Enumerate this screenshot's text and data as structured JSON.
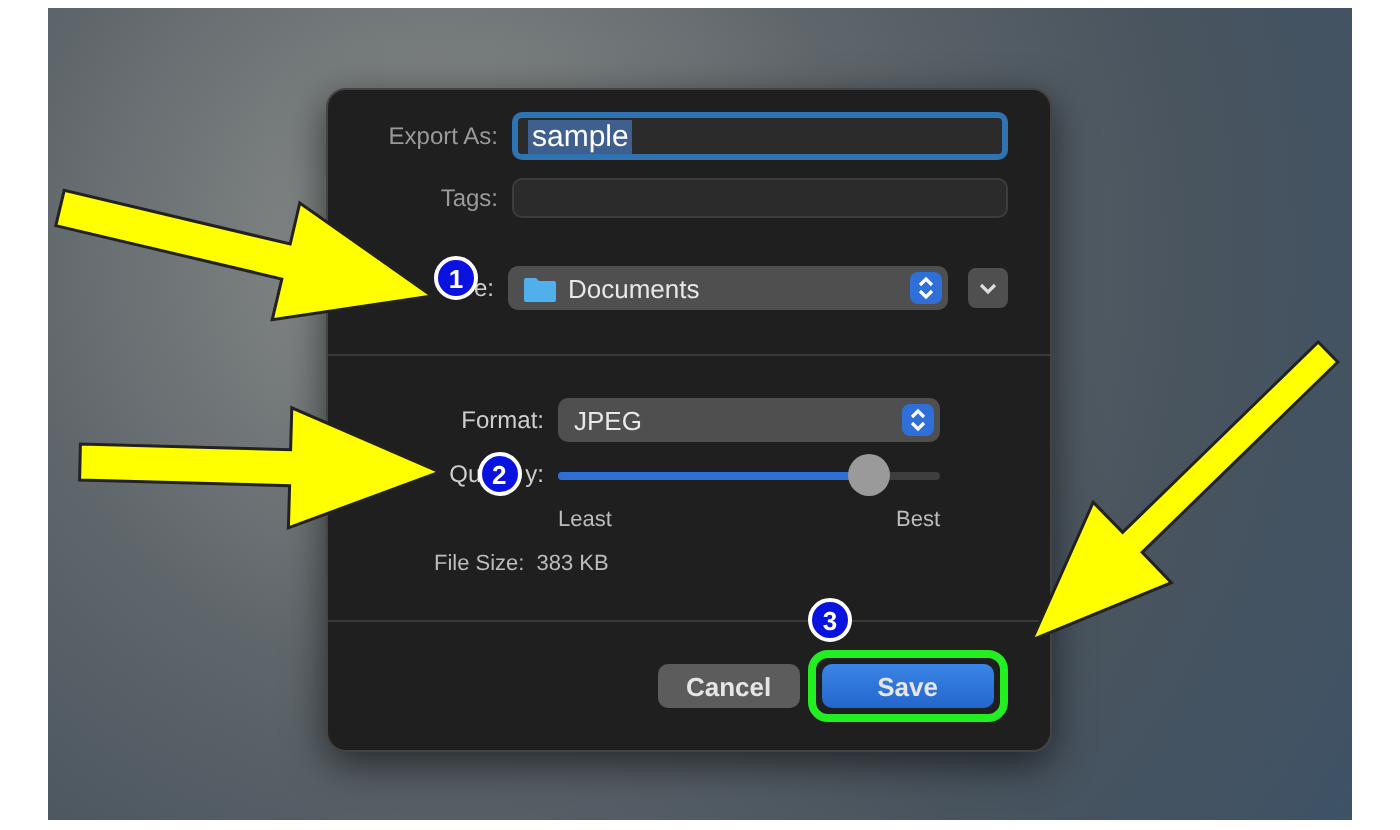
{
  "dialog": {
    "export_as": {
      "label": "Export As:",
      "value": "sample",
      "value_selected": true
    },
    "tags": {
      "label": "Tags:"
    },
    "where": {
      "label": "e:",
      "value": "Documents"
    },
    "format": {
      "label": "Format:",
      "value": "JPEG"
    },
    "quality": {
      "label_parts": [
        "Qu",
        "y:"
      ],
      "level": 0.81,
      "min_label": "Least",
      "max_label": "Best"
    },
    "file_size": {
      "label": "File Size:",
      "value": "383 KB"
    },
    "buttons": [
      {
        "label": "Cancel",
        "kind": "secondary"
      },
      {
        "label": "Save",
        "kind": "primary"
      }
    ]
  },
  "annotations": [
    {
      "number": "1"
    },
    {
      "number": "2"
    },
    {
      "number": "3"
    }
  ]
}
